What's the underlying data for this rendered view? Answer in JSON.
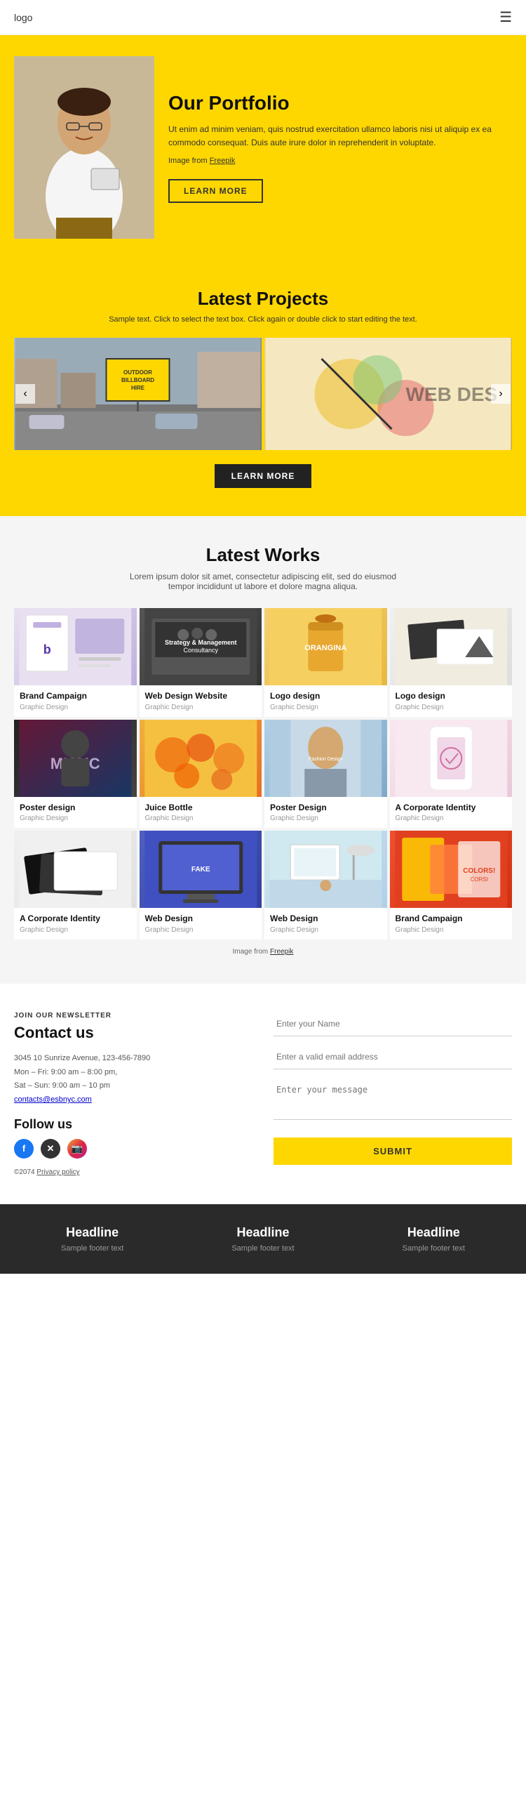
{
  "header": {
    "logo": "logo",
    "hamburger": "☰"
  },
  "hero": {
    "title": "Our Portfolio",
    "description": "Ut enim ad minim veniam, quis nostrud exercitation ullamco laboris nisi ut aliquip ex ea commodo consequat. Duis aute irure dolor in reprehenderit in voluptate.",
    "image_note": "Image from Freepik",
    "freepik_link": "Freepik",
    "btn_label": "LEARN MORE"
  },
  "projects": {
    "title": "Latest Projects",
    "subtitle": "Sample text. Click to select the text box. Click again or double click to start editing the text.",
    "btn_label": "LEARN MORE",
    "carousel_left": "‹",
    "carousel_right": "›",
    "items": [
      {
        "label": "OUTDOOR BILLBOARD HIRE",
        "type": "street"
      },
      {
        "label": "WEB DES",
        "type": "web"
      }
    ]
  },
  "works": {
    "title": "Latest Works",
    "subtitle": "Lorem ipsum dolor sit amet, consectetur adipiscing elit, sed do eiusmod tempor incididunt ut labore et dolore magna aliqua.",
    "freepik_note": "Image from Freepik",
    "items": [
      {
        "title": "Brand Campaign",
        "category": "Graphic Design",
        "thumb": "brand"
      },
      {
        "title": "Web Design Website",
        "category": "Graphic Design",
        "thumb": "webdesign"
      },
      {
        "title": "Logo design",
        "category": "Graphic Design",
        "thumb": "logo"
      },
      {
        "title": "Logo design",
        "category": "Graphic Design",
        "thumb": "logo2"
      },
      {
        "title": "Poster design",
        "category": "Graphic Design",
        "thumb": "poster"
      },
      {
        "title": "Juice Bottle",
        "category": "Graphic Design",
        "thumb": "juice"
      },
      {
        "title": "Poster Design",
        "category": "Graphic Design",
        "thumb": "poster2"
      },
      {
        "title": "A Corporate Identity",
        "category": "Graphic Design",
        "thumb": "corporate"
      },
      {
        "title": "A Corporate Identity",
        "category": "Graphic Design",
        "thumb": "corp2"
      },
      {
        "title": "Web Design",
        "category": "Graphic Design",
        "thumb": "webdesign2"
      },
      {
        "title": "Web Design",
        "category": "Graphic Design",
        "thumb": "webdesign3"
      },
      {
        "title": "Brand Campaign",
        "category": "Graphic Design",
        "thumb": "brand2"
      }
    ]
  },
  "contact": {
    "tag": "JOIN OUR NEWSLETTER",
    "title": "Contact us",
    "address": "3045 10 Sunrize Avenue, 123-456-7890\nMon – Fri: 9:00 am – 8:00 pm,\nSat – Sun: 9:00 am – 10 pm",
    "email": "contacts@esbnyc.com",
    "follow_title": "Follow us",
    "copyright": "©2074 Privacy policy",
    "form": {
      "name_placeholder": "Enter your Name",
      "email_placeholder": "Enter a valid email address",
      "message_placeholder": "Enter your message",
      "submit_label": "SUBMIT"
    }
  },
  "footer": {
    "columns": [
      {
        "headline": "Headline",
        "text": "Sample footer text"
      },
      {
        "headline": "Headline",
        "text": "Sample footer text"
      },
      {
        "headline": "Headline",
        "text": "Sample footer text"
      }
    ]
  }
}
